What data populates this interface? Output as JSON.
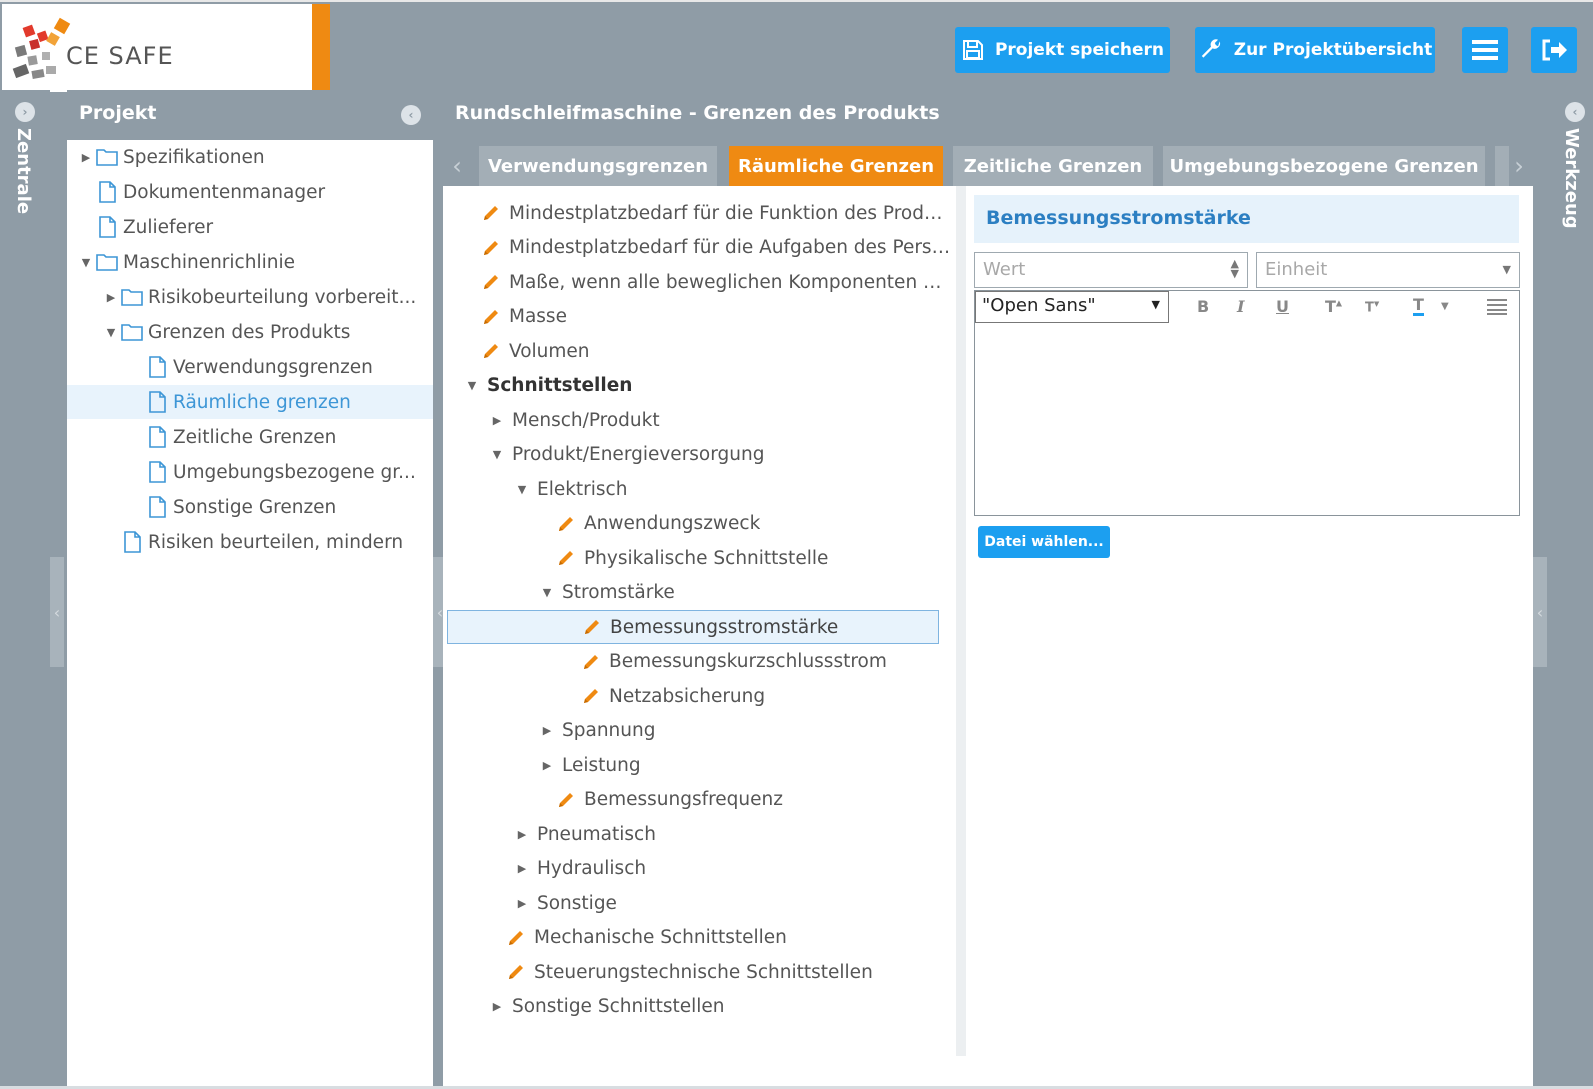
{
  "app": {
    "logo_text": "CE SAFE",
    "save_label": "Projekt speichern",
    "overview_label": "Zur Projektübersicht",
    "brand_color": "#1c9ff0",
    "accent_color": "#ef8a12"
  },
  "rails": {
    "left_label": "Zentrale",
    "right_label": "Werkzeug"
  },
  "project": {
    "title": "Projekt",
    "items": [
      {
        "label": "Spezifikationen",
        "type": "folder",
        "expander": "collapsed"
      },
      {
        "label": "Dokumentenmanager",
        "type": "file"
      },
      {
        "label": "Zulieferer",
        "type": "file"
      },
      {
        "label": "Maschinenrichlinie",
        "type": "folder",
        "expander": "expanded"
      },
      {
        "label": "Risikobeurteilung vorbereit...",
        "type": "folder",
        "expander": "collapsed"
      },
      {
        "label": "Grenzen des Produkts",
        "type": "folder",
        "expander": "expanded"
      },
      {
        "label": "Verwendungsgrenzen",
        "type": "file"
      },
      {
        "label": "Räumliche grenzen",
        "type": "file",
        "selected": true
      },
      {
        "label": "Zeitliche Grenzen",
        "type": "file"
      },
      {
        "label": "Umgebungsbezogene gr...",
        "type": "file"
      },
      {
        "label": "Sonstige Grenzen",
        "type": "file"
      },
      {
        "label": "Risiken beurteilen, mindern",
        "type": "file"
      }
    ]
  },
  "main": {
    "title": "Rundschleifmaschine - Grenzen des Produkts",
    "tabs": [
      {
        "label": "Verwendungsgrenzen"
      },
      {
        "label": "Räumliche Grenzen",
        "active": true
      },
      {
        "label": "Zeitliche Grenzen"
      },
      {
        "label": "Umgebungsbezogene Grenzen"
      }
    ]
  },
  "content_tree": [
    {
      "label": "Mindestplatzbedarf für die Funktion des Produkts",
      "kind": "edit"
    },
    {
      "label": "Mindestplatzbedarf für die Aufgaben des Perso...",
      "kind": "edit"
    },
    {
      "label": "Maße, wenn alle beweglichen Komponenten ein...",
      "kind": "edit"
    },
    {
      "label": "Masse",
      "kind": "edit"
    },
    {
      "label": "Volumen",
      "kind": "edit"
    },
    {
      "label": "Schnittstellen",
      "kind": "group",
      "expander": "expanded"
    },
    {
      "label": "Mensch/Produkt",
      "kind": "group",
      "expander": "collapsed"
    },
    {
      "label": "Produkt/Energieversorgung",
      "kind": "group",
      "expander": "expanded"
    },
    {
      "label": "Elektrisch",
      "kind": "group",
      "expander": "expanded"
    },
    {
      "label": "Anwendungszweck",
      "kind": "edit"
    },
    {
      "label": "Physikalische Schnittstelle",
      "kind": "edit"
    },
    {
      "label": "Stromstärke",
      "kind": "group",
      "expander": "expanded"
    },
    {
      "label": "Bemessungsstromstärke",
      "kind": "edit",
      "selected": true
    },
    {
      "label": "Bemessungskurzschlussstrom",
      "kind": "edit"
    },
    {
      "label": "Netzabsicherung",
      "kind": "edit"
    },
    {
      "label": "Spannung",
      "kind": "group",
      "expander": "collapsed"
    },
    {
      "label": "Leistung",
      "kind": "group",
      "expander": "collapsed"
    },
    {
      "label": "Bemessungsfrequenz",
      "kind": "edit"
    },
    {
      "label": "Pneumatisch",
      "kind": "group",
      "expander": "collapsed"
    },
    {
      "label": "Hydraulisch",
      "kind": "group",
      "expander": "collapsed"
    },
    {
      "label": "Sonstige",
      "kind": "group",
      "expander": "collapsed"
    },
    {
      "label": "Mechanische Schnittstellen",
      "kind": "edit"
    },
    {
      "label": "Steuerungstechnische Schnittstellen",
      "kind": "edit"
    },
    {
      "label": "Sonstige Schnittstellen",
      "kind": "group",
      "expander": "collapsed"
    }
  ],
  "detail": {
    "title": "Bemessungsstromstärke",
    "value_placeholder": "Wert",
    "unit_placeholder": "Einheit",
    "font_value": "\"Open Sans\"",
    "toolbar": {
      "bold": "B",
      "italic": "I",
      "underline": "U",
      "superscript": "T",
      "subscript": "T",
      "color": "T"
    },
    "file_button": "Datei wählen..."
  }
}
